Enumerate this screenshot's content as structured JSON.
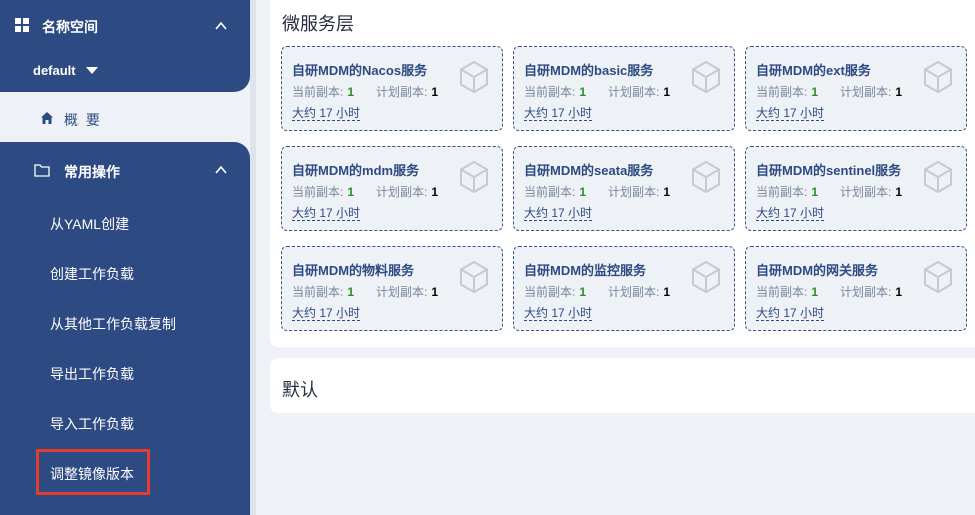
{
  "sidebar": {
    "namespace_title": "名称空间",
    "namespace_selected": "default",
    "overview_label": "概 要",
    "ops_title": "常用操作",
    "ops_items": [
      {
        "label": "从YAML创建"
      },
      {
        "label": "创建工作负载"
      },
      {
        "label": "从其他工作负载复制"
      },
      {
        "label": "导出工作负载"
      },
      {
        "label": "导入工作负载"
      },
      {
        "label": "调整镜像版本"
      }
    ],
    "highlighted_item": "调整镜像版本"
  },
  "main": {
    "layer_title": "微服务层",
    "services": [
      {
        "name": "自研MDM的Nacos服务",
        "current_label": "当前副本:",
        "current": "1",
        "planned_label": "计划副本:",
        "planned": "1",
        "age": "大约 17 小时"
      },
      {
        "name": "自研MDM的basic服务",
        "current_label": "当前副本:",
        "current": "1",
        "planned_label": "计划副本:",
        "planned": "1",
        "age": "大约 17 小时"
      },
      {
        "name": "自研MDM的ext服务",
        "current_label": "当前副本:",
        "current": "1",
        "planned_label": "计划副本:",
        "planned": "1",
        "age": "大约 17 小时"
      },
      {
        "name": "自研MDM的mdm服务",
        "current_label": "当前副本:",
        "current": "1",
        "planned_label": "计划副本:",
        "planned": "1",
        "age": "大约 17 小时"
      },
      {
        "name": "自研MDM的seata服务",
        "current_label": "当前副本:",
        "current": "1",
        "planned_label": "计划副本:",
        "planned": "1",
        "age": "大约 17 小时"
      },
      {
        "name": "自研MDM的sentinel服务",
        "current_label": "当前副本:",
        "current": "1",
        "planned_label": "计划副本:",
        "planned": "1",
        "age": "大约 17 小时"
      },
      {
        "name": "自研MDM的物料服务",
        "current_label": "当前副本:",
        "current": "1",
        "planned_label": "计划副本:",
        "planned": "1",
        "age": "大约 17 小时"
      },
      {
        "name": "自研MDM的监控服务",
        "current_label": "当前副本:",
        "current": "1",
        "planned_label": "计划副本:",
        "planned": "1",
        "age": "大约 17 小时"
      },
      {
        "name": "自研MDM的网关服务",
        "current_label": "当前副本:",
        "current": "1",
        "planned_label": "计划副本:",
        "planned": "1",
        "age": "大约 17 小时"
      }
    ],
    "default_title": "默认"
  },
  "colors": {
    "sidebar_bg": "#2d4a83",
    "accent": "#2d4a83",
    "replica_current": "#2a8f2a",
    "highlight_box": "#e33b2e"
  }
}
